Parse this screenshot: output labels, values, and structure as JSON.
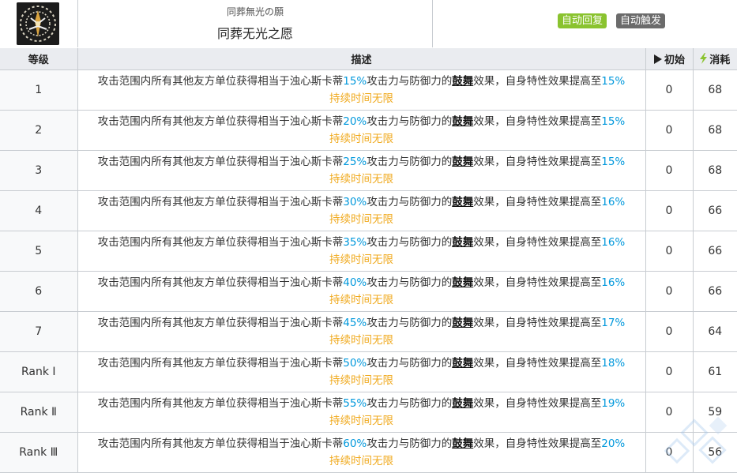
{
  "header": {
    "name_jp": "同葬無光の願",
    "name_cn": "同葬无光之愿",
    "icon": "skill-emblem-icon",
    "tags": [
      "自动回复",
      "自动触发"
    ]
  },
  "columns": {
    "level": "等级",
    "description": "描述",
    "initial": "初始",
    "cost": "消耗",
    "initial_icon": "play-icon",
    "cost_icon": "lightning-icon"
  },
  "description_parts": {
    "prefix": "攻击范围内所有其他友方单位获得相当于浊心斯卡蒂",
    "middle": "攻击力与防御力的",
    "keyword": "鼓舞",
    "suffix": "效果，自身特性效果提高至",
    "duration": "持续时间无限"
  },
  "rows": [
    {
      "level": "1",
      "atk": "15%",
      "trait": "15%",
      "initial": "0",
      "cost": "68"
    },
    {
      "level": "2",
      "atk": "20%",
      "trait": "15%",
      "initial": "0",
      "cost": "68"
    },
    {
      "level": "3",
      "atk": "25%",
      "trait": "15%",
      "initial": "0",
      "cost": "68"
    },
    {
      "level": "4",
      "atk": "30%",
      "trait": "16%",
      "initial": "0",
      "cost": "66"
    },
    {
      "level": "5",
      "atk": "35%",
      "trait": "16%",
      "initial": "0",
      "cost": "66"
    },
    {
      "level": "6",
      "atk": "40%",
      "trait": "16%",
      "initial": "0",
      "cost": "66"
    },
    {
      "level": "7",
      "atk": "45%",
      "trait": "17%",
      "initial": "0",
      "cost": "64"
    },
    {
      "level": "Rank Ⅰ",
      "atk": "50%",
      "trait": "18%",
      "initial": "0",
      "cost": "61"
    },
    {
      "level": "Rank Ⅱ",
      "atk": "55%",
      "trait": "19%",
      "initial": "0",
      "cost": "59"
    },
    {
      "level": "Rank Ⅲ",
      "atk": "60%",
      "trait": "20%",
      "initial": "0",
      "cost": "56"
    }
  ],
  "colors": {
    "highlight": "#0098dc",
    "duration": "#f0a91c",
    "tag_auto_recover": "#8ac32f",
    "tag_auto_trigger": "#6b6b6b",
    "header_bg": "#eaecf0"
  }
}
